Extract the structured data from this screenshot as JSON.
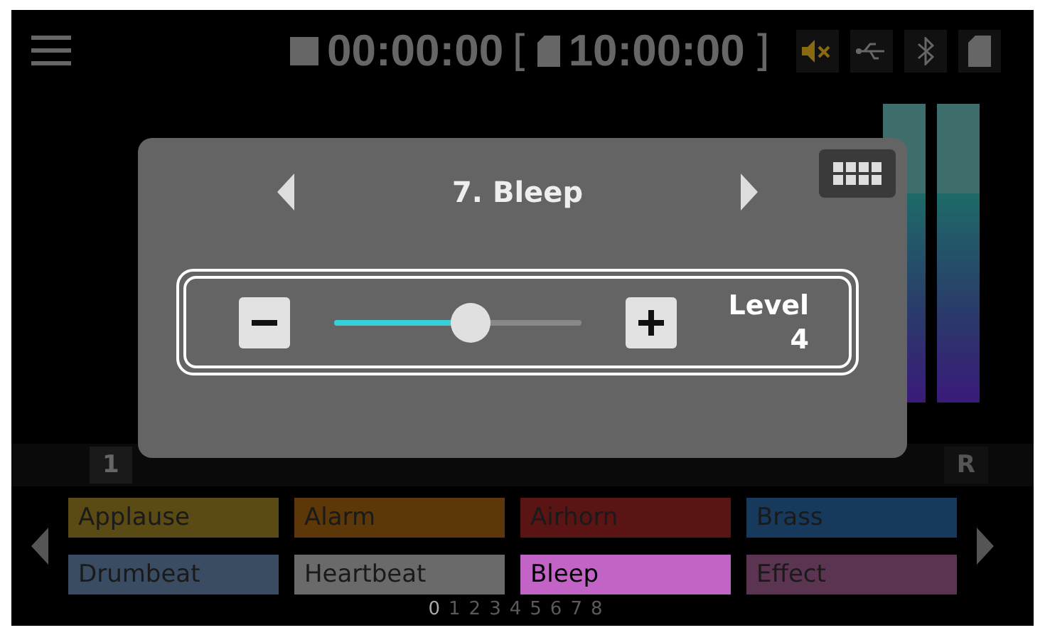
{
  "status_bar": {
    "elapsed": "00:00:00",
    "bracket_open": "[",
    "remaining": "10:00:00",
    "bracket_close": "]",
    "muted": true
  },
  "mixer": {
    "channels": [
      {
        "label": "1",
        "selected": true
      },
      {
        "label": "R",
        "selected": false
      }
    ]
  },
  "dialog": {
    "title": "7. Bleep",
    "control": {
      "label": "Level",
      "value": "4",
      "level": 0.55
    }
  },
  "pads": [
    {
      "label": "Applause",
      "color": "#5a4a14",
      "selected": false
    },
    {
      "label": "Alarm",
      "color": "#5c3808",
      "selected": false
    },
    {
      "label": "Airhorn",
      "color": "#5a1414",
      "selected": false
    },
    {
      "label": "Brass",
      "color": "#173a5c",
      "selected": false
    },
    {
      "label": "Drumbeat",
      "color": "#3a4c62",
      "selected": false
    },
    {
      "label": "Heartbeat",
      "color": "#6a6a6a",
      "selected": false
    },
    {
      "label": "Bleep",
      "color": "#c264c6",
      "selected": true
    },
    {
      "label": "Effect",
      "color": "#5a3450",
      "selected": false
    }
  ],
  "pages": [
    {
      "label": "0",
      "selected": true
    },
    {
      "label": "1",
      "selected": false
    },
    {
      "label": "2",
      "selected": false
    },
    {
      "label": "3",
      "selected": false
    },
    {
      "label": "4",
      "selected": false
    },
    {
      "label": "5",
      "selected": false
    },
    {
      "label": "6",
      "selected": false
    },
    {
      "label": "7",
      "selected": false
    },
    {
      "label": "8",
      "selected": false
    }
  ]
}
